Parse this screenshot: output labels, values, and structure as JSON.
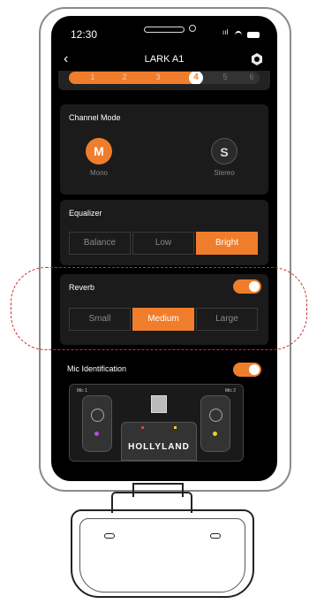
{
  "status": {
    "time": "12:30",
    "signal": "ııl"
  },
  "nav": {
    "title": "LARK A1"
  },
  "level_slider": {
    "steps": [
      "1",
      "2",
      "3",
      "4",
      "5",
      "6"
    ],
    "current": "4"
  },
  "channel_mode": {
    "label": "Channel Mode",
    "options": [
      {
        "letter": "M",
        "name": "Mono",
        "selected": true
      },
      {
        "letter": "S",
        "name": "Stereo",
        "selected": false
      }
    ]
  },
  "equalizer": {
    "label": "Equalizer",
    "options": [
      "Balance",
      "Low",
      "Bright"
    ],
    "selected": "Bright"
  },
  "reverb": {
    "label": "Reverb",
    "enabled": true,
    "options": [
      "Small",
      "Medium",
      "Large"
    ],
    "selected": "Medium"
  },
  "mic_identification": {
    "label": "Mic Identification",
    "enabled": true,
    "mic1": "Mic 1",
    "mic2": "Mic 2",
    "brand": "HOLLYLAND"
  },
  "colors": {
    "accent": "#f07d2b",
    "highlight_outline": "#c72b2b"
  }
}
